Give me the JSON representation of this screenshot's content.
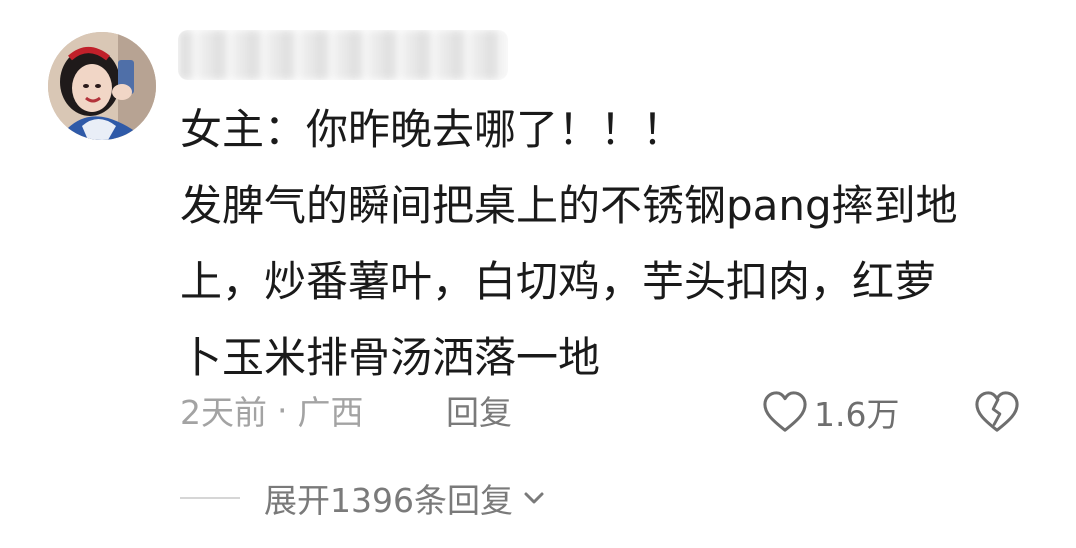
{
  "comment": {
    "username": "",
    "body_lines": [
      "女主：你昨晚去哪了！！！",
      "发脾气的瞬间把桌上的不锈钢pang摔到地",
      "上，炒番薯叶，白切鸡，芋头扣肉，红萝",
      "卜玉米排骨汤洒落一地"
    ],
    "time": "2天前",
    "separator": "·",
    "location": "广西",
    "reply_label": "回复",
    "like_count": "1.6万",
    "expand_label": "展开1396条回复"
  },
  "icons": {
    "avatar": "avatar-image",
    "like": "heart-outline-icon",
    "dislike": "broken-heart-icon",
    "expand": "chevron-down-icon"
  },
  "colors": {
    "text_primary": "#1a1a1a",
    "text_meta": "#a3a3a3",
    "text_action": "#7a7a7a",
    "icon": "#6e6e6e"
  }
}
